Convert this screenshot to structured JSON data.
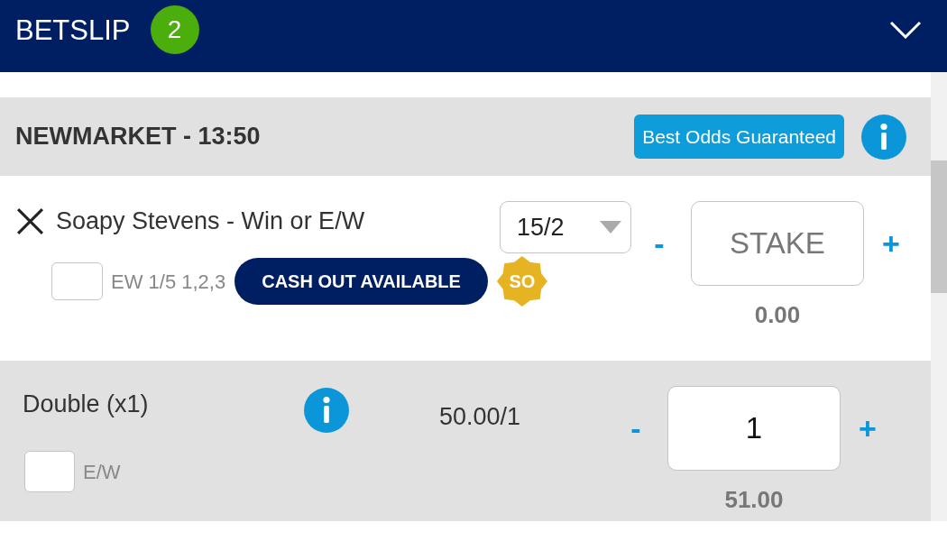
{
  "header": {
    "title": "BETSLIP",
    "count": "2"
  },
  "event": {
    "title": "NEWMARKET - 13:50",
    "badge": "Best Odds Guaranteed"
  },
  "selections": [
    {
      "name": "Soapy Stevens - Win or E/W",
      "odds": "15/2",
      "each_way": {
        "label": "EW 1/5 1,2,3",
        "checked": false
      },
      "cash_out": "CASH OUT AVAILABLE",
      "so_badge": "SO",
      "decrease": "-",
      "stake": {
        "placeholder": "STAKE"
      },
      "increase": "+",
      "returns": "0.00"
    }
  ],
  "multiples": [
    {
      "name": "Double (x1)",
      "odds": "50.00/1",
      "each_way": {
        "label": "E/W",
        "checked": false
      },
      "decrease": "-",
      "stake": {
        "value": "1"
      },
      "increase": "+",
      "returns": "51.00"
    }
  ]
}
